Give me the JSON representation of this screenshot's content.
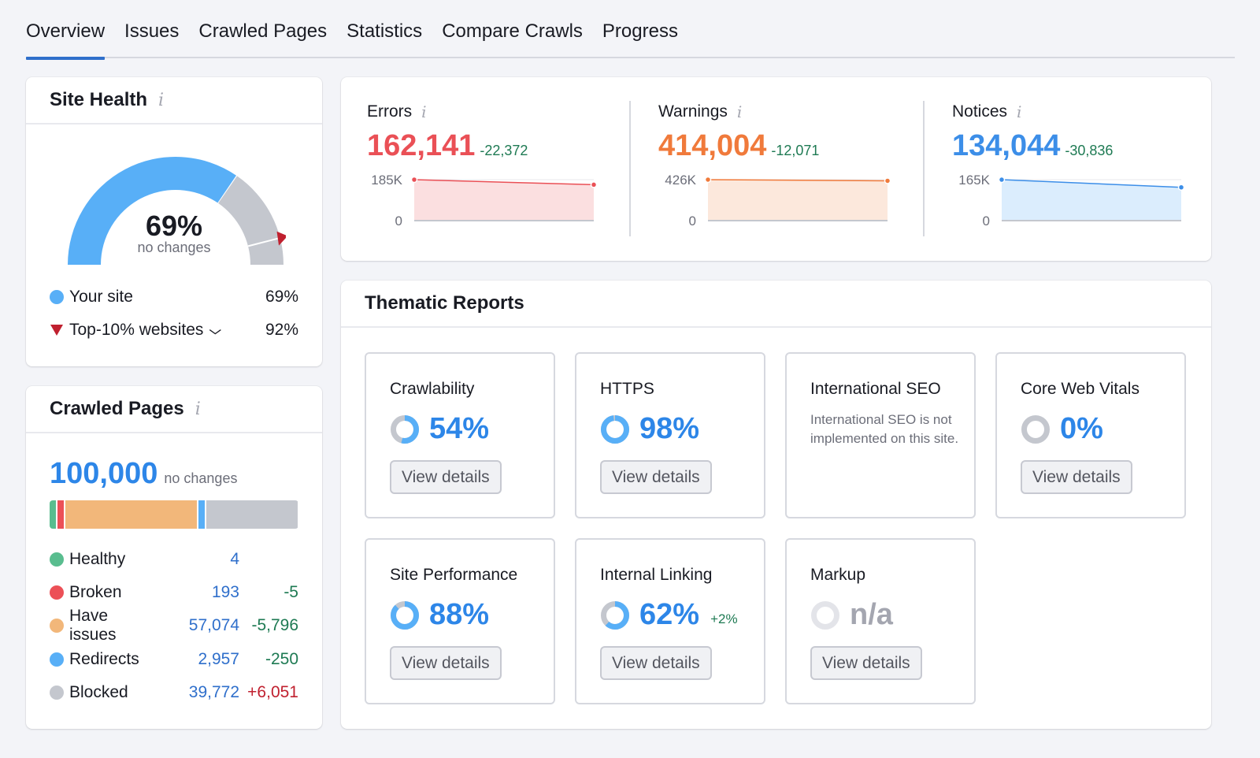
{
  "tabs": [
    {
      "label": "Overview",
      "active": true
    },
    {
      "label": "Issues",
      "active": false
    },
    {
      "label": "Crawled Pages",
      "active": false
    },
    {
      "label": "Statistics",
      "active": false
    },
    {
      "label": "Compare Crawls",
      "active": false
    },
    {
      "label": "Progress",
      "active": false
    }
  ],
  "site_health": {
    "title": "Site Health",
    "info_icon": "i",
    "score": "69%",
    "score_value": 69,
    "top10_value": 92,
    "change_text": "no changes",
    "colors": {
      "your_site": "#58aff7",
      "rest": "#c4c7ce",
      "marker": "#c0202f"
    },
    "legend": [
      {
        "label": "Your site",
        "value": "69%",
        "icon": "circle-blue"
      },
      {
        "label": "Top-10% websites",
        "value": "92%",
        "icon": "triangle-red",
        "has_dropdown": true,
        "dropdown_icon": "⌄"
      }
    ]
  },
  "crawled_pages": {
    "title": "Crawled Pages",
    "info_icon": "i",
    "total": "100,000",
    "change_text": "no changes",
    "rows": [
      {
        "label": "Healthy",
        "count": "4",
        "delta": "",
        "color": "#59bd8f",
        "count_value": 4
      },
      {
        "label": "Broken",
        "count": "193",
        "delta": "-5",
        "color": "#ec5057",
        "count_value": 193
      },
      {
        "label": "Have issues",
        "count": "57,074",
        "delta": "-5,796",
        "color": "#f2b77a",
        "count_value": 57074
      },
      {
        "label": "Redirects",
        "count": "2,957",
        "delta": "-250",
        "color": "#58aff7",
        "count_value": 2957
      },
      {
        "label": "Blocked",
        "count": "39,772",
        "delta": "+6,051",
        "color": "#c4c7ce",
        "count_value": 39772
      }
    ]
  },
  "issues": [
    {
      "title": "Errors",
      "info_icon": "i",
      "value": "162,141",
      "delta": "-22,372",
      "color": "#ea5056",
      "fill": "#fbdfe0",
      "y_max_label": "185K",
      "y_min_label": "0",
      "series": [
        185000,
        162141
      ],
      "y_max": 185000
    },
    {
      "title": "Warnings",
      "info_icon": "i",
      "value": "414,004",
      "delta": "-12,071",
      "color": "#f07a3b",
      "fill": "#fce8dc",
      "y_max_label": "426K",
      "y_min_label": "0",
      "series": [
        426075,
        414004
      ],
      "y_max": 426000
    },
    {
      "title": "Notices",
      "info_icon": "i",
      "value": "134,044",
      "delta": "-30,836",
      "color": "#3c8ee8",
      "fill": "#dbedfd",
      "y_max_label": "165K",
      "y_min_label": "0",
      "series": [
        164880,
        134044
      ],
      "y_max": 165000
    }
  ],
  "thematic_reports": {
    "title": "Thematic Reports",
    "button_label": "View details",
    "reports": [
      {
        "title": "Crawlability",
        "score": "54%",
        "value": 54,
        "delta": "",
        "has_button": true
      },
      {
        "title": "HTTPS",
        "score": "98%",
        "value": 98,
        "delta": "",
        "has_button": true
      },
      {
        "title": "International SEO",
        "description": "International SEO is not implemented on this site.",
        "has_button": false
      },
      {
        "title": "Core Web Vitals",
        "score": "0%",
        "value": 0,
        "delta": "",
        "has_button": true
      },
      {
        "title": "Site Performance",
        "score": "88%",
        "value": 88,
        "delta": "",
        "has_button": true
      },
      {
        "title": "Internal Linking",
        "score": "62%",
        "value": 62,
        "delta": "+2%",
        "has_button": true
      },
      {
        "title": "Markup",
        "score": "n/a",
        "value": null,
        "delta": "",
        "has_button": true
      }
    ]
  }
}
